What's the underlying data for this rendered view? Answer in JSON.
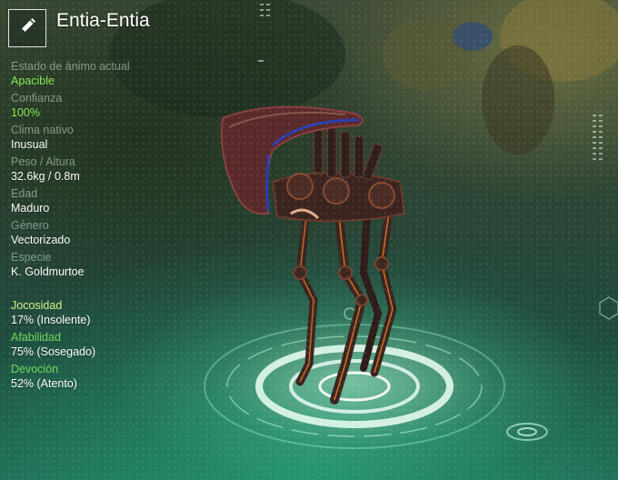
{
  "creature": {
    "name": "Entia-Entia"
  },
  "colors": {
    "accent_green": "#8ef15a",
    "trait_yellow": "#d8f08a",
    "trait_green": "#72d95a",
    "label_muted": "#a9c0b0"
  },
  "icons": {
    "edit": "pencil-icon"
  },
  "stats": [
    {
      "label": "Estado de ánimo actual",
      "value": "Apacible"
    },
    {
      "label": "Confianza",
      "value": "100%"
    },
    {
      "label": "Clima nativo",
      "value": "Inusual"
    },
    {
      "label": "Peso / Altura",
      "value": "32.6kg / 0.8m"
    },
    {
      "label": "Edad",
      "value": "Maduro"
    },
    {
      "label": "Género",
      "value": "Vectorizado"
    },
    {
      "label": "Especie",
      "value": "K. Goldmurtoe"
    }
  ],
  "traits": [
    {
      "label": "Jocosidad",
      "value": "17% (Insolente)"
    },
    {
      "label": "Afabilidad",
      "value": "75% (Sosegado)"
    },
    {
      "label": "Devoción",
      "value": "52% (Atento)"
    }
  ]
}
